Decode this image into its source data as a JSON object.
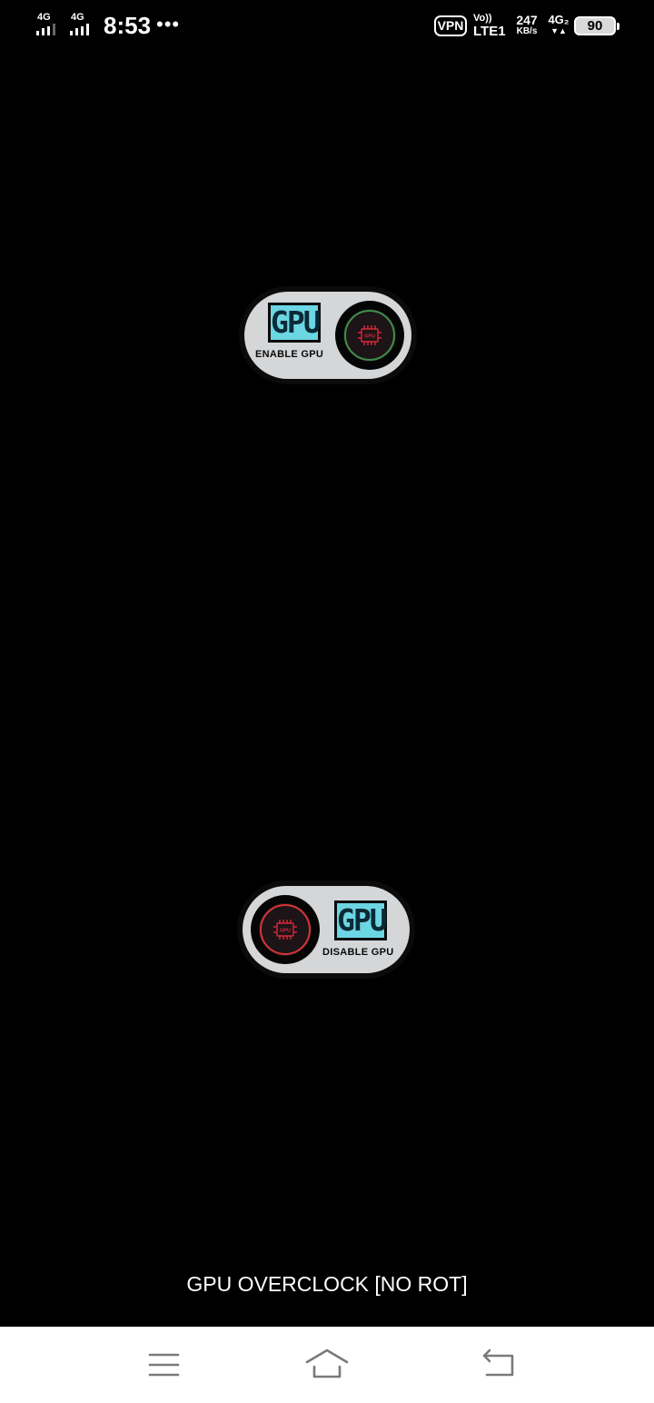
{
  "status_bar": {
    "sim1_label": "4G",
    "sim2_label": "4G",
    "time": "8:53",
    "more": "•••",
    "vpn": "VPN",
    "volte_top": "Vo))",
    "volte_bottom": "LTE1",
    "speed_value": "247",
    "speed_unit": "KB/s",
    "network2": "4G₂",
    "network2_arrows": "▼▲",
    "battery": "90"
  },
  "enable_button": {
    "logo": "GPU",
    "label": "ENABLE GPU",
    "chip_text": "GPU",
    "ring_color": "#3f8f4a",
    "chip_color": "#d8283a"
  },
  "disable_button": {
    "logo": "GPU",
    "label": "DISABLE GPU",
    "chip_text": "GPU",
    "ring_color": "#d8333a",
    "chip_color": "#d8283a"
  },
  "app": {
    "title": "GPU OVERCLOCK [NO ROT]"
  },
  "nav": {
    "menu_icon": "menu-icon",
    "home_icon": "home-icon",
    "back_icon": "back-icon"
  }
}
